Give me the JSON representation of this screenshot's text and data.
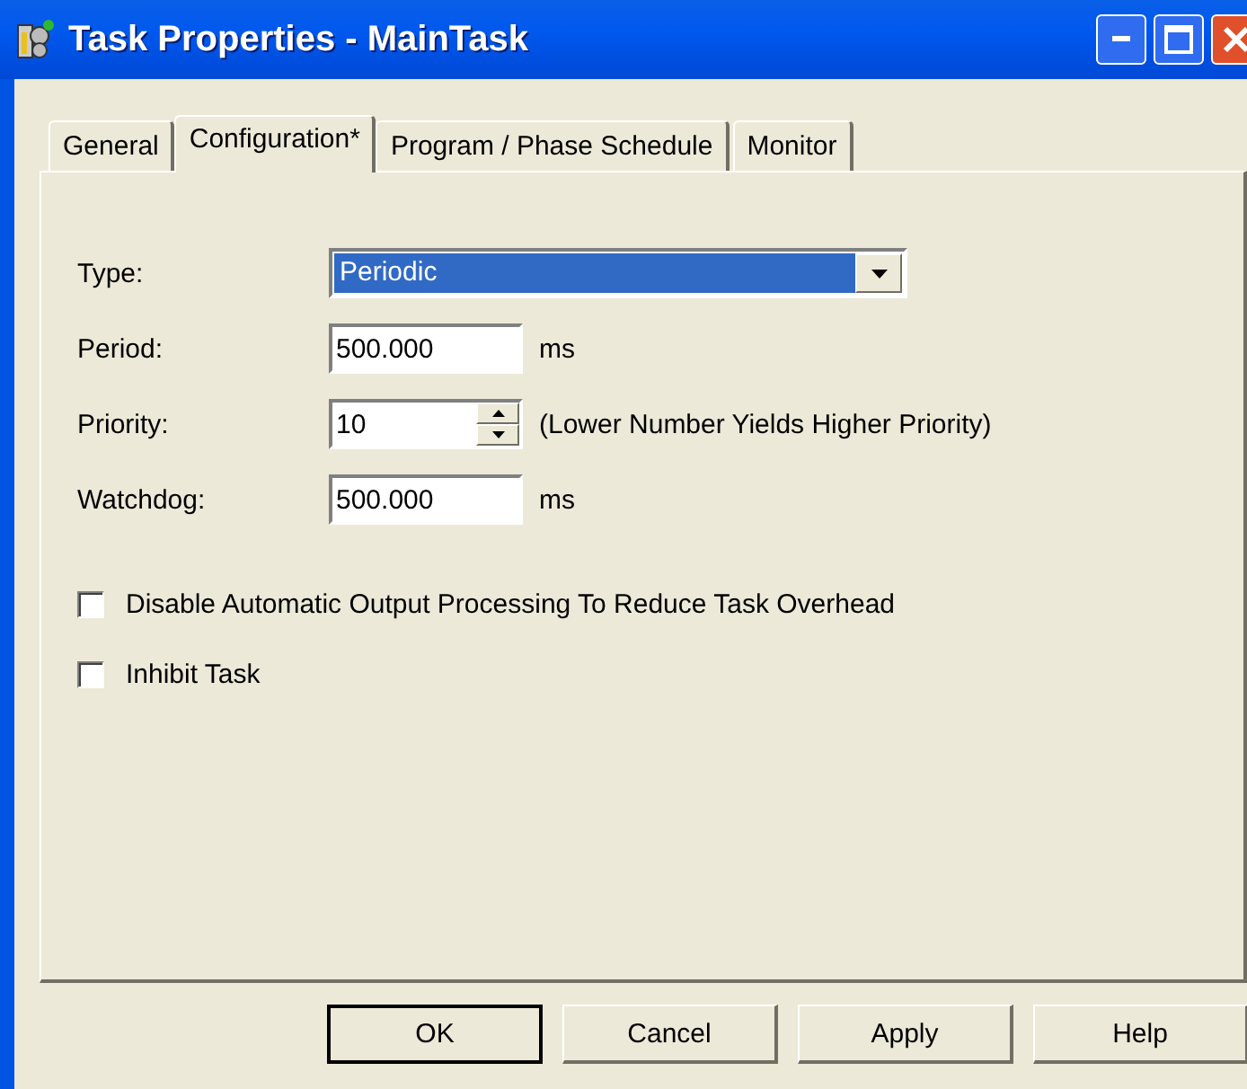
{
  "window": {
    "title": "Task Properties - MainTask"
  },
  "tabs": [
    {
      "label": "General",
      "selected": false
    },
    {
      "label": "Configuration*",
      "selected": true
    },
    {
      "label": "Program / Phase Schedule",
      "selected": false
    },
    {
      "label": "Monitor",
      "selected": false
    }
  ],
  "fields": [
    {
      "kind": "combo",
      "label": "Type:",
      "value": "Periodic"
    },
    {
      "kind": "text",
      "label": "Period:",
      "value": "500.000",
      "unit": "ms"
    },
    {
      "kind": "spin",
      "label": "Priority:",
      "value": "10",
      "note": "(Lower Number Yields Higher Priority)"
    },
    {
      "kind": "text",
      "label": "Watchdog:",
      "value": "500.000",
      "unit": "ms"
    }
  ],
  "checkboxes": [
    {
      "label": "Disable Automatic Output Processing To Reduce Task Overhead",
      "checked": false
    },
    {
      "label": "Inhibit Task",
      "checked": false
    }
  ],
  "buttons": [
    {
      "label": "OK",
      "default": true
    },
    {
      "label": "Cancel",
      "default": false
    },
    {
      "label": "Apply",
      "default": false
    },
    {
      "label": "Help",
      "default": false
    }
  ]
}
